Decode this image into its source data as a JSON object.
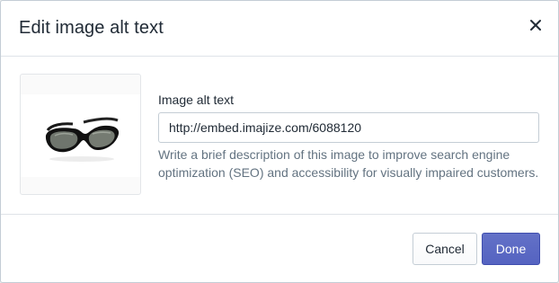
{
  "modal": {
    "title": "Edit image alt text",
    "close_icon": "close-icon"
  },
  "image": {
    "description": "product thumbnail of black sunglasses"
  },
  "alt_field": {
    "label": "Image alt text",
    "value": "http://embed.imajize.com/6088120",
    "help_text": "Write a brief description of this image to improve search engine optimization (SEO) and accessibility for visually impaired customers."
  },
  "footer": {
    "cancel_label": "Cancel",
    "done_label": "Done"
  },
  "colors": {
    "primary": "#5c6ac4",
    "text": "#212b36",
    "subdued_text": "#637381",
    "border": "#c4cdd5",
    "divider": "#dfe3e8"
  }
}
